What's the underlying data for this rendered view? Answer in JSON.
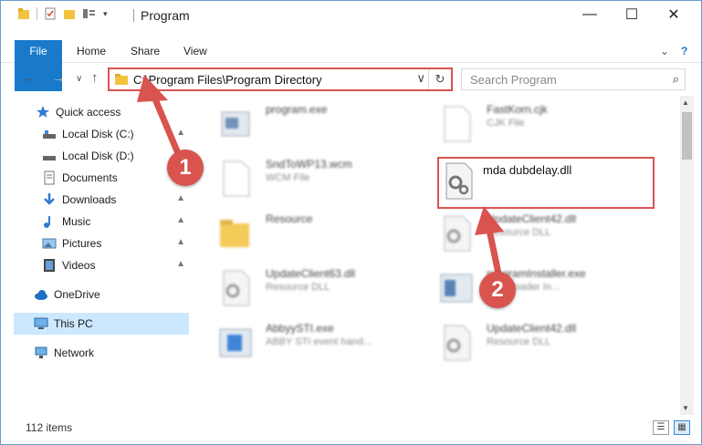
{
  "window": {
    "title": "Program",
    "minimize": "—",
    "maximize": "☐",
    "close": "✕"
  },
  "ribbon": {
    "tabs": [
      "File",
      "Home",
      "Share",
      "View"
    ],
    "help_icon": "?",
    "expand_icon": "⌄"
  },
  "address": {
    "path": "C:\\Program Files\\Program Directory",
    "dropdown": "∨",
    "refresh": "↻"
  },
  "search": {
    "placeholder": "Search Program",
    "icon": "⌕"
  },
  "nav": {
    "back": "←",
    "forward": "→",
    "recent": "∨",
    "up": "↑",
    "items": [
      {
        "label": "Quick access",
        "icon": "star-icon"
      },
      {
        "label": "Local Disk (C:)",
        "icon": "drive-icon"
      },
      {
        "label": "Local Disk (D:)",
        "icon": "drive-icon"
      },
      {
        "label": "Documents",
        "icon": "documents-icon"
      },
      {
        "label": "Downloads",
        "icon": "downloads-icon"
      },
      {
        "label": "Music",
        "icon": "music-icon"
      },
      {
        "label": "Pictures",
        "icon": "pictures-icon"
      },
      {
        "label": "Videos",
        "icon": "videos-icon"
      },
      {
        "label": "OneDrive",
        "icon": "cloud-icon"
      },
      {
        "label": "This PC",
        "icon": "computer-icon"
      },
      {
        "label": "Network",
        "icon": "network-icon"
      }
    ],
    "pin": "📌"
  },
  "files": [
    {
      "name": "program.exe",
      "type": ""
    },
    {
      "name": "FastKorn.cjk",
      "type": "CJK File"
    },
    {
      "name": "SndToWP13.wcm",
      "type": "WCM File"
    },
    {
      "name": "mda dubdelay.dll",
      "type": ""
    },
    {
      "name": "Resource",
      "type": ""
    },
    {
      "name": "UpdateClient42.dll",
      "type": "Resource DLL"
    },
    {
      "name": "UpdateClient63.dll",
      "type": "Resource DLL"
    },
    {
      "name": "programInstaller.exe",
      "type": "Downloader In..."
    },
    {
      "name": "AbbyySTI.exe",
      "type": "ABBY STI event hand..."
    },
    {
      "name": "UpdateClient42.dll",
      "type": "Resource DLL"
    }
  ],
  "status": {
    "count": "112 items"
  },
  "annotations": {
    "step1": "1",
    "step2": "2"
  }
}
